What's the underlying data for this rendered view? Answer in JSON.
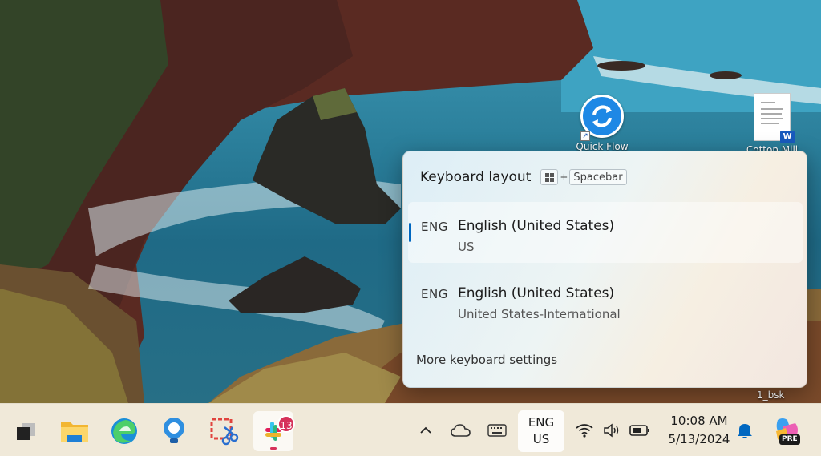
{
  "desktop": {
    "icons": [
      {
        "label": "Quick Flow"
      },
      {
        "label": "Cotton Mill"
      }
    ],
    "user_label": "1_bsk"
  },
  "keyboard_flyout": {
    "title": "Keyboard layout",
    "shortcut": {
      "win_icon": "windows-logo-icon",
      "plus": "+",
      "key": "Spacebar"
    },
    "layouts": [
      {
        "code": "ENG",
        "name": "English (United States)",
        "variant": "US",
        "selected": true
      },
      {
        "code": "ENG",
        "name": "English (United States)",
        "variant": "United States-International",
        "selected": false
      }
    ],
    "more_settings": "More keyboard settings"
  },
  "taskbar": {
    "apps": [
      {
        "icon": "task-view-icon"
      },
      {
        "icon": "file-explorer-icon"
      },
      {
        "icon": "edge-icon"
      },
      {
        "icon": "tips-lightbulb-icon"
      },
      {
        "icon": "snipping-tool-icon"
      },
      {
        "icon": "slack-icon",
        "badge": "13",
        "active": true
      }
    ],
    "tray": {
      "chevron_icon": "chevron-up-icon",
      "onedrive_icon": "cloud-icon",
      "keyboard_icon": "touch-keyboard-icon",
      "language": {
        "line1": "ENG",
        "line2": "US"
      },
      "wifi_icon": "wifi-icon",
      "volume_icon": "volume-icon",
      "battery_icon": "battery-icon",
      "time": "10:08 AM",
      "date": "5/13/2024",
      "notification_icon": "bell-icon",
      "copilot_icon": "copilot-icon",
      "copilot_badge": "PRE"
    }
  },
  "colors": {
    "accent": "#0067c0",
    "taskbar": "#f0e9d9",
    "badge": "#d6325a"
  }
}
